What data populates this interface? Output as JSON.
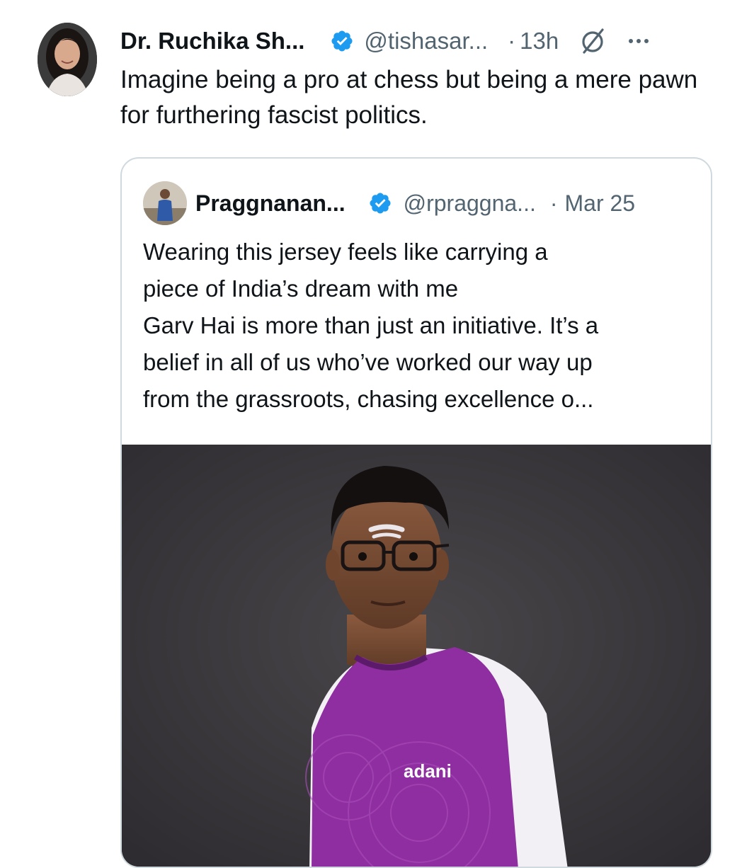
{
  "tweet": {
    "display_name": "Dr. Ruchika Sh...",
    "handle": "@tishasar...",
    "separator": "·",
    "time": "13h",
    "text": "Imagine being a pro at chess but being a mere pawn for furthering fascist politics.",
    "icons": {
      "verified": "verified-badge-icon",
      "grok": "grok-icon",
      "more": "more-options-icon"
    }
  },
  "quote": {
    "display_name": "Praggnanan...",
    "handle": "@rpraggna...",
    "separator": "·",
    "time": "Mar 25",
    "text": "Wearing this jersey feels like carrying a\npiece of India’s dream with me\nGarv Hai is more than just an initiative. It’s a\nbelief in all of us who’ve worked our way up\nfrom the grassroots, chasing excellence o...",
    "media": {
      "jersey_logo": "adani"
    }
  },
  "colors": {
    "verified_blue": "#1d9bf0",
    "secondary_text": "#536471",
    "border": "#cfd9de",
    "jersey_purple": "#8e2ea0"
  }
}
